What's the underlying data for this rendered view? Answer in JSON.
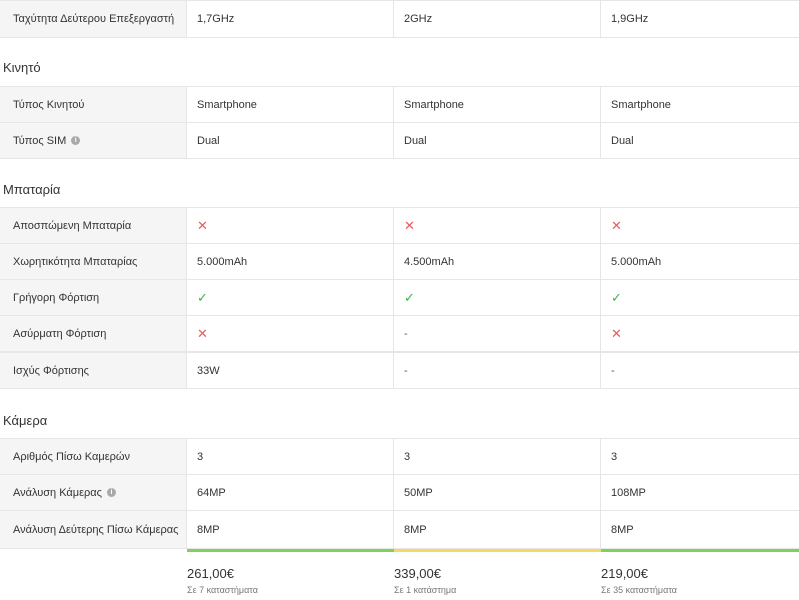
{
  "processor_row": {
    "label": "Ταχύτητα Δεύτερου Επεξεργαστή",
    "values": [
      "1,7GHz",
      "2GHz",
      "1,9GHz"
    ]
  },
  "sections": {
    "phone": {
      "title": "Κινητό",
      "rows": [
        {
          "label": "Τύπος Κινητού",
          "values": [
            "Smartphone",
            "Smartphone",
            "Smartphone"
          ]
        },
        {
          "label": "Τύπος SIM",
          "values": [
            "Dual",
            "Dual",
            "Dual"
          ],
          "info": true
        }
      ]
    },
    "battery": {
      "title": "Μπαταρία",
      "rows": [
        {
          "label": "Αποσπώμενη Μπαταρία",
          "values": [
            "no",
            "no",
            "no"
          ]
        },
        {
          "label": "Χωρητικότητα Μπαταρίας",
          "values": [
            "5.000mAh",
            "4.500mAh",
            "5.000mAh"
          ]
        },
        {
          "label": "Γρήγορη Φόρτιση",
          "values": [
            "yes",
            "yes",
            "yes"
          ]
        },
        {
          "label": "Ασύρματη Φόρτιση",
          "values": [
            "no",
            "-",
            "no"
          ]
        },
        {
          "label": "Ισχύς Φόρτισης",
          "values": [
            "33W",
            "-",
            "-"
          ]
        }
      ]
    },
    "camera": {
      "title": "Κάμερα",
      "rows": [
        {
          "label": "Αριθμός Πίσω Καμερών",
          "values": [
            "3",
            "3",
            "3"
          ]
        },
        {
          "label": "Ανάλυση Κάμερας",
          "values": [
            "64MP",
            "50MP",
            "108MP"
          ],
          "info": true
        },
        {
          "label": "Ανάλυση Δεύτερης Πίσω Κάμερας",
          "values": [
            "8MP",
            "8MP",
            "8MP"
          ]
        }
      ]
    }
  },
  "info_icon_glyph": "i",
  "symbols": {
    "no": "✕",
    "yes": "✓",
    "dash": "-"
  },
  "colors": {
    "cross": "#e85c5c",
    "check": "#3ab54a",
    "bar_green": "#7dd35a",
    "bar_yellow": "#f2dc5d"
  },
  "prices": [
    {
      "price": "261,00€",
      "stores": "Σε 7 καταστήματα",
      "bar": "green"
    },
    {
      "price": "339,00€",
      "stores": "Σε 1 κατάστημα",
      "bar": "yellow"
    },
    {
      "price": "219,00€",
      "stores": "Σε 35 καταστήματα",
      "bar": "green"
    }
  ]
}
